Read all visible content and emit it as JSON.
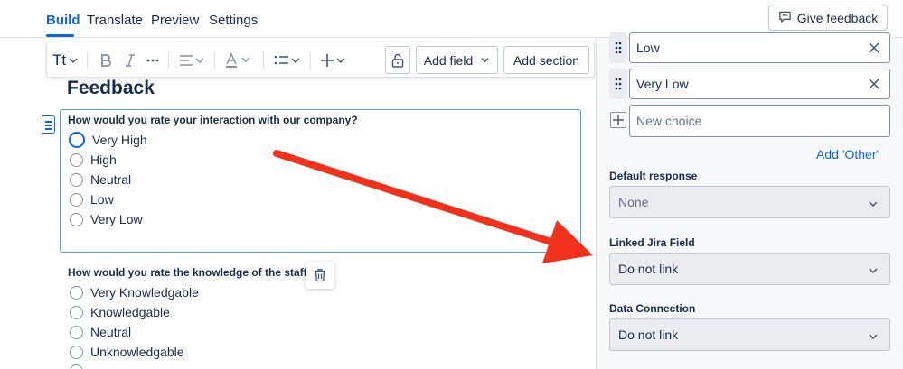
{
  "nav": {
    "tabs": [
      {
        "label": "Build",
        "active": true
      },
      {
        "label": "Translate",
        "active": false
      },
      {
        "label": "Preview",
        "active": false
      },
      {
        "label": "Settings",
        "active": false
      }
    ],
    "feedback_label": "Give feedback"
  },
  "toolbar": {
    "text_style_label": "Tt",
    "add_field_label": "Add field",
    "add_section_label": "Add section"
  },
  "form": {
    "title": "Feedback",
    "questions": [
      {
        "label": "How would you rate your interaction with our company?",
        "options": [
          "Very High",
          "High",
          "Neutral",
          "Low",
          "Very Low"
        ]
      },
      {
        "label": "How would you rate the knowledge of the staff?",
        "options": [
          "Very Knowledgable",
          "Knowledgable",
          "Neutral",
          "Unknowledgable"
        ]
      }
    ]
  },
  "panel": {
    "choices": [
      "Low",
      "Very Low"
    ],
    "new_choice_placeholder": "New choice",
    "add_other_label": "Add 'Other'",
    "default_response": {
      "label": "Default response",
      "value": "None"
    },
    "linked_jira_field": {
      "label": "Linked Jira Field",
      "value": "Do not link"
    },
    "data_connection": {
      "label": "Data Connection",
      "value": "Do not link"
    }
  },
  "colors": {
    "accent": "#0c66e4",
    "annotation_arrow": "#f2311d"
  },
  "icons": [
    "feedback-icon",
    "bold-icon",
    "italic-icon",
    "more-icon",
    "align-icon",
    "text-color-icon",
    "list-icon",
    "insert-icon",
    "unlock-icon",
    "chevron-down-icon",
    "trash-icon",
    "drag-handle-icon",
    "close-icon",
    "plus-icon"
  ]
}
